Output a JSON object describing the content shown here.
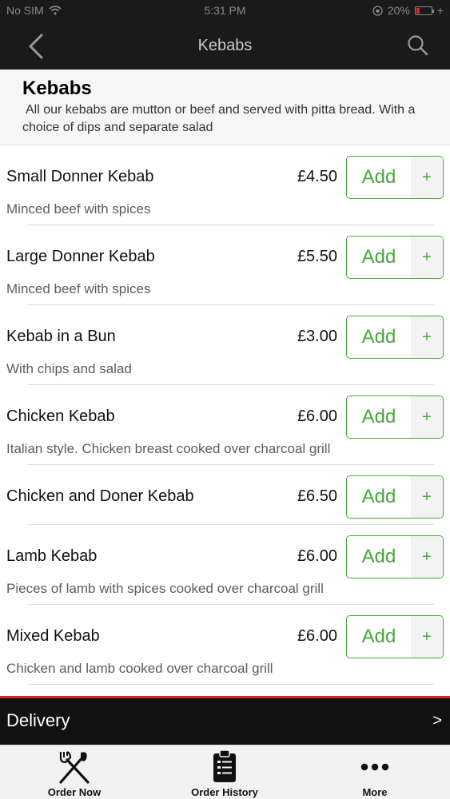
{
  "status_bar": {
    "carrier": "No SIM",
    "time": "5:31 PM",
    "battery": "20%",
    "battery_level": 0.2,
    "charging_symbol": "+"
  },
  "nav": {
    "title": "Kebabs",
    "back_icon": "chevron-left-icon",
    "search_icon": "search-icon"
  },
  "category": {
    "title": "Kebabs",
    "description": "All our kebabs are mutton or beef and served with pitta bread. With a choice of dips and separate salad"
  },
  "items": [
    {
      "name": "Small Donner Kebab",
      "price": "£4.50",
      "description": "Minced beef with spices"
    },
    {
      "name": "Large Donner Kebab",
      "price": "£5.50",
      "description": "Minced beef with spices"
    },
    {
      "name": "Kebab in a Bun",
      "price": "£3.00",
      "description": "With chips and salad"
    },
    {
      "name": "Chicken Kebab",
      "price": "£6.00",
      "description": "Italian style. Chicken breast cooked over charcoal grill"
    },
    {
      "name": "Chicken and Doner Kebab",
      "price": "£6.50",
      "description": ""
    },
    {
      "name": "Lamb Kebab",
      "price": "£6.00",
      "description": "Pieces of lamb with spices cooked over charcoal grill"
    },
    {
      "name": "Mixed Kebab",
      "price": "£6.00",
      "description": "Chicken and lamb cooked over charcoal grill"
    }
  ],
  "add_button": {
    "label": "Add",
    "plus": "+"
  },
  "delivery": {
    "label": "Delivery",
    "arrow": ">"
  },
  "tabs": [
    {
      "label": "Order Now",
      "icon": "fork-knife-icon"
    },
    {
      "label": "Order History",
      "icon": "clipboard-list-icon"
    },
    {
      "label": "More",
      "icon": "more-dots-icon"
    }
  ],
  "colors": {
    "accent_green": "#46a83c",
    "delivery_border_red": "#cf2a1f",
    "header_dark": "#1a1a1a"
  }
}
